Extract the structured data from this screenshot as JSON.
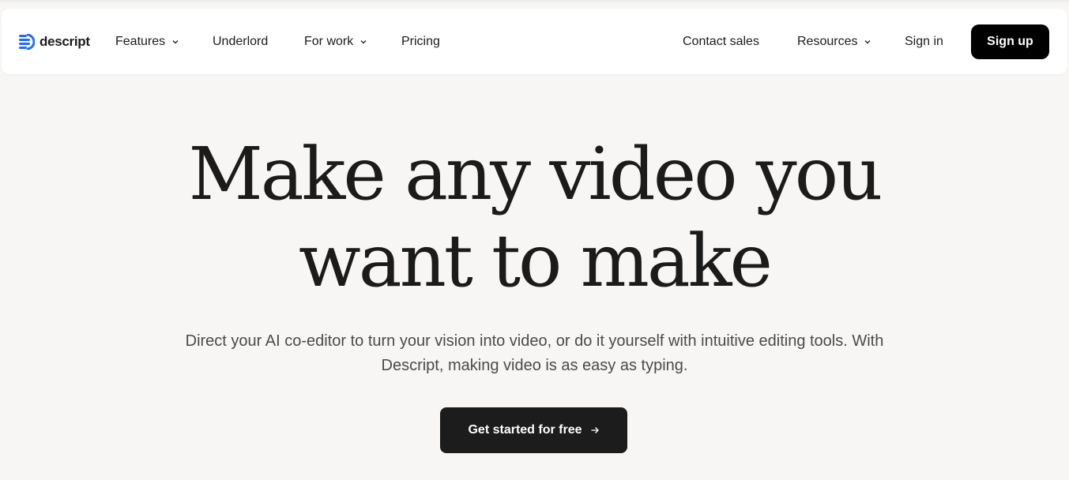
{
  "brand": {
    "name": "descript",
    "accent": "#1f6bff"
  },
  "nav": {
    "features": "Features",
    "underlord": "Underlord",
    "for_work": "For work",
    "pricing": "Pricing",
    "contact_sales": "Contact sales",
    "resources": "Resources",
    "sign_in": "Sign in",
    "sign_up": "Sign up"
  },
  "hero": {
    "title_line1": "Make any video you",
    "title_line2": "want to make",
    "subtitle": "Direct your AI co-editor to turn your vision into video, or do it yourself with intuitive editing tools. With Descript, making video is as easy as typing.",
    "cta_label": "Get started for free",
    "cta_icon": "arrow-right-icon"
  },
  "icons": {
    "chevron": "chevron-down-icon",
    "logo": "descript-logo-icon"
  }
}
